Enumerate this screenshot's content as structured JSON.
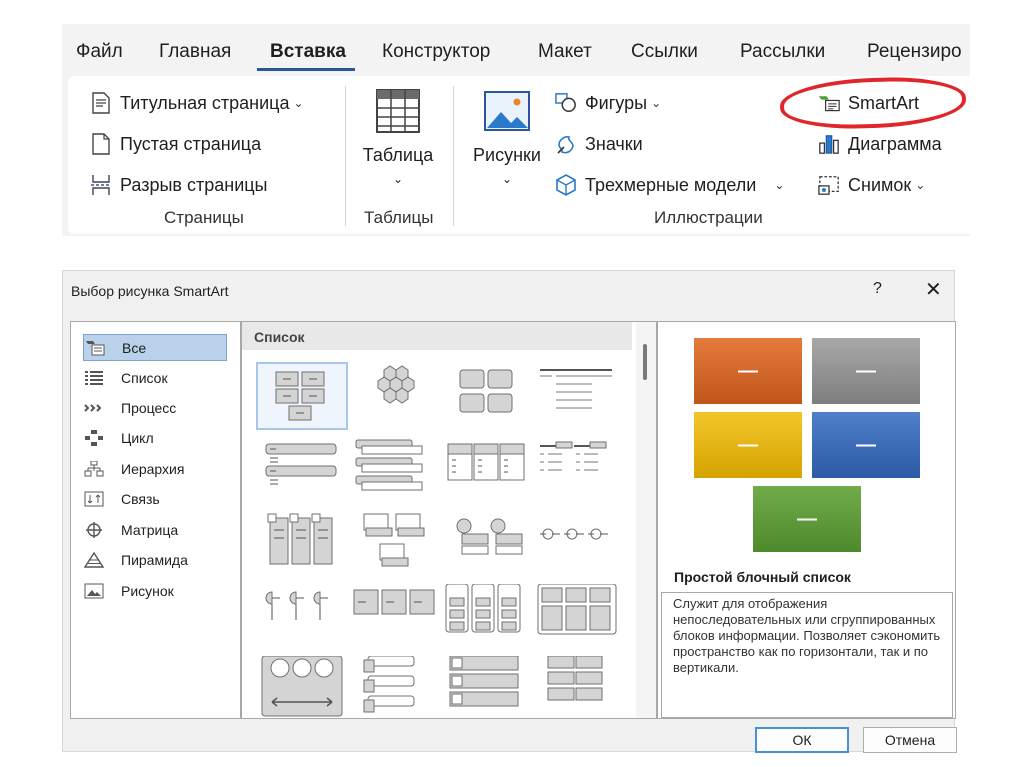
{
  "ribbon": {
    "tabs": [
      "Файл",
      "Главная",
      "Вставка",
      "Конструктор",
      "Макет",
      "Ссылки",
      "Рассылки",
      "Рецензиро"
    ],
    "active_tab": "Вставка",
    "pages_group": {
      "label": "Страницы",
      "items": [
        "Титульная страница",
        "Пустая страница",
        "Разрыв страницы"
      ]
    },
    "tables_group": {
      "label": "Таблицы",
      "button": "Таблица"
    },
    "illustrations_group": {
      "label": "Иллюстрации",
      "pictures": "Рисунки",
      "shapes": "Фигуры",
      "icons": "Значки",
      "models3d": "Трехмерные модели",
      "smartart": "SmartArt",
      "chart": "Диаграмма",
      "screenshot": "Снимок"
    },
    "accent_color": "#2b579a",
    "highlight_color": "#e0262b"
  },
  "dialog": {
    "title": "Выбор рисунка SmartArt",
    "help": "?",
    "close": "✕",
    "categories": [
      "Все",
      "Список",
      "Процесс",
      "Цикл",
      "Иерархия",
      "Связь",
      "Матрица",
      "Пирамида",
      "Рисунок"
    ],
    "selected_category": "Все",
    "section_header": "Список",
    "preview": {
      "dash": "—",
      "colors": [
        "#d2662a",
        "#959595",
        "#e8b80f",
        "#3b6cb7",
        "#5f9b3a"
      ]
    },
    "layout_name": "Простой блочный список",
    "description": "Служит для отображения непоследовательных или сгруппированных блоков информации. Позволяет сэкономить пространство как по горизонтали, так и по вертикали.",
    "ok_label": "ОК",
    "cancel_label": "Отмена"
  }
}
